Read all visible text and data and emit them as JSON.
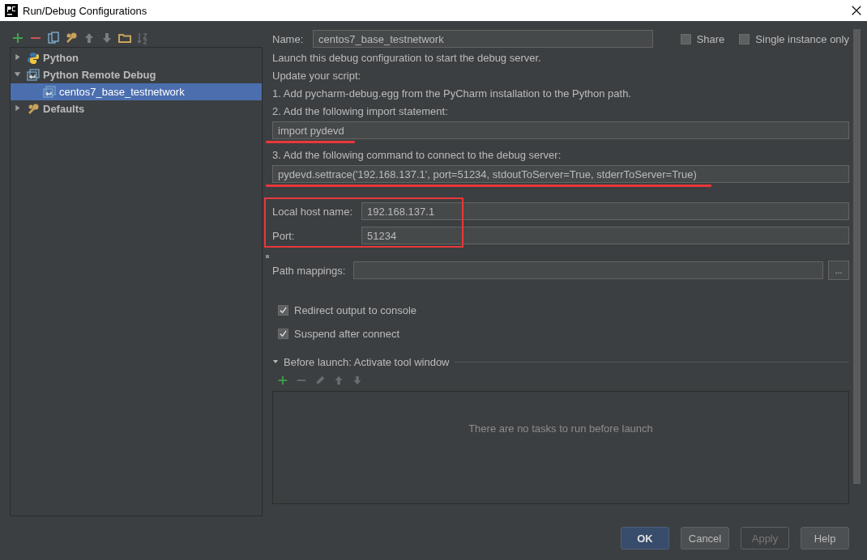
{
  "window": {
    "title": "Run/Debug Configurations"
  },
  "tree": [
    {
      "kind": "python",
      "label": "Python",
      "expanded": false,
      "selected": false
    },
    {
      "kind": "remote",
      "label": "Python Remote Debug",
      "expanded": true,
      "selected": false,
      "children": [
        {
          "kind": "remote",
          "label": "centos7_base_testnetwork",
          "selected": true
        }
      ]
    },
    {
      "kind": "defaults",
      "label": "Defaults",
      "expanded": false,
      "selected": false
    }
  ],
  "name_field": {
    "label": "Name:",
    "value": "centos7_base_testnetwork"
  },
  "options": [
    {
      "label": "Share",
      "checked": false
    },
    {
      "label": "Single instance only",
      "checked": false
    }
  ],
  "instructions": [
    {
      "kind": "text",
      "text": "Launch this debug configuration to start the debug server."
    },
    {
      "kind": "text",
      "text": "Update your script:"
    },
    {
      "kind": "text",
      "text": "1. Add pycharm-debug.egg from the PyCharm installation to the Python path."
    },
    {
      "kind": "text",
      "text": "2. Add the following import statement:"
    },
    {
      "kind": "code",
      "value": "import pydevd"
    },
    {
      "kind": "text",
      "text": "3. Add the following command to connect to the debug server:"
    },
    {
      "kind": "code",
      "value": "pydevd.settrace('192.168.137.1', port=51234, stdoutToServer=True, stderrToServer=True)"
    }
  ],
  "connection": [
    {
      "label": "Local host name:",
      "value": "192.168.137.1"
    },
    {
      "label": "Port:",
      "value": "51234"
    }
  ],
  "path_mappings": {
    "label": "Path mappings:",
    "browse": "..."
  },
  "checkboxes": [
    {
      "label": "Redirect output to console",
      "checked": true
    },
    {
      "label": "Suspend after connect",
      "checked": true
    }
  ],
  "before_launch": {
    "title": "Before launch: Activate tool window",
    "expanded": true,
    "empty_text": "There are no tasks to run before launch"
  },
  "buttons": [
    {
      "label": "OK",
      "default": true,
      "disabled": false
    },
    {
      "label": "Cancel",
      "default": false,
      "disabled": false
    },
    {
      "label": "Apply",
      "default": false,
      "disabled": true
    },
    {
      "label": "Help",
      "default": false,
      "disabled": false
    }
  ]
}
